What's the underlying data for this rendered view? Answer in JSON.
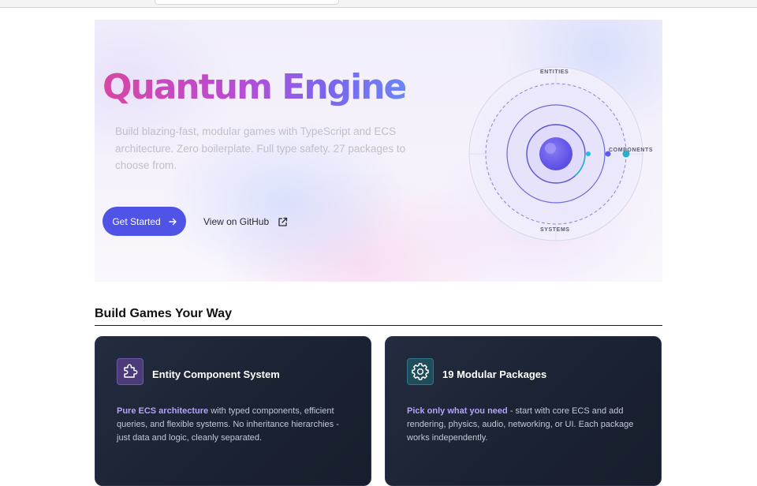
{
  "hero": {
    "title": "Quantum Engine",
    "description": "Build blazing-fast, modular games with TypeScript and ECS architecture. Zero boilerplate. Full type safety. 27 packages to choose from.",
    "primary_button": "Get Started",
    "secondary_link": "View on GitHub",
    "diagram": {
      "label_top": "ENTITIES",
      "label_right": "COMPONENTS",
      "label_bottom": "SYSTEMS"
    }
  },
  "section": {
    "title": "Build Games Your Way"
  },
  "cards": [
    {
      "icon": "puzzle-icon",
      "title": "Entity Component System",
      "highlight": "Pure ECS architecture",
      "body": " with typed components, efficient queries, and flexible systems. No inheritance hierarchies - just data and logic, cleanly separated."
    },
    {
      "icon": "gear-icon",
      "title": "19 Modular Packages",
      "highlight": "Pick only what you need",
      "body": " - start with core ECS and add rendering, physics, audio, networking, or UI. Each package works independently."
    }
  ],
  "colors": {
    "accent": "#4f53e6",
    "title_gradient_start": "#d846a3",
    "title_gradient_end": "#6c85f4",
    "card_background": "#1d2435",
    "card_highlight": "#b3a4f5"
  }
}
